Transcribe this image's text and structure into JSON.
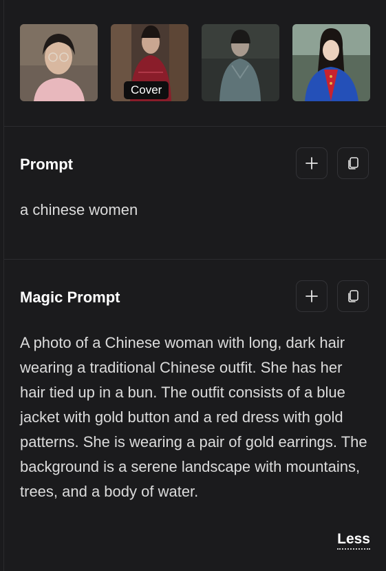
{
  "gallery": {
    "cover_label": "Cover",
    "images": [
      {
        "icon": "portrait-woman-glasses-pink-shirt"
      },
      {
        "icon": "portrait-woman-red-dress"
      },
      {
        "icon": "portrait-woman-blue-gray-outfit"
      },
      {
        "icon": "portrait-woman-blue-jacket-red-dress"
      }
    ]
  },
  "prompt": {
    "title": "Prompt",
    "text": "a chinese women"
  },
  "magic_prompt": {
    "title": "Magic Prompt",
    "text": "A photo of a Chinese woman with long, dark hair wearing a traditional Chinese outfit. She has her hair tied up in a bun. The outfit consists of a blue jacket with gold button and a red dress with gold patterns. She is wearing a pair of gold earrings. The background is a serene landscape with mountains, trees, and a body of water."
  },
  "less_label": "Less",
  "icons": {
    "add": "plus-icon",
    "copy": "copy-icon"
  },
  "colors": {
    "background": "#1b1b1d",
    "text": "#dcdcdc",
    "title": "#ffffff",
    "button_border": "#333337"
  }
}
